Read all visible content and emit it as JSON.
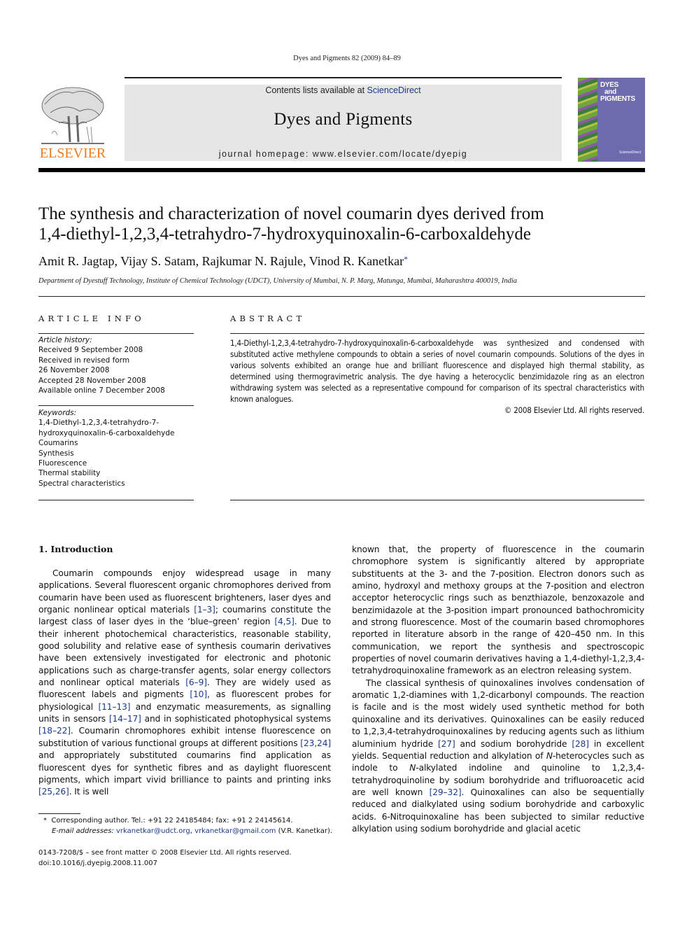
{
  "running_head": "Dyes and Pigments 82 (2009) 84–89",
  "banner": {
    "contents_prefix": "Contents lists available at ",
    "contents_link": "ScienceDirect",
    "journal_title": "Dyes and Pigments",
    "homepage": "journal homepage: www.elsevier.com/locate/dyepig"
  },
  "publisher_logo": {
    "wordmark": "ELSEVIER",
    "icon": "elsevier-tree-icon",
    "color": "#f07a1c"
  },
  "cover": {
    "title_lines": [
      "DYES",
      "and",
      "PIGMENTS"
    ],
    "footer": "ScienceDirect",
    "color": "#6e6aae"
  },
  "article": {
    "title_line1": "The synthesis and characterization of novel coumarin dyes derived from",
    "title_line2": "1,4-diethyl-1,2,3,4-tetrahydro-7-hydroxyquinoxalin-6-carboxaldehyde",
    "authors": "Amit R. Jagtap, Vijay S. Satam, Rajkumar N. Rajule, Vinod R. Kanetkar",
    "author_mark": "*",
    "affiliation": "Department of Dyestuff Technology, Institute of Chemical Technology (UDCT), University of Mumbai, N. P. Marg, Matunga, Mumbai, Maharashtra 400019, India"
  },
  "article_info": {
    "heading": "ARTICLE INFO",
    "history_label": "Article history:",
    "history": [
      "Received 9 September 2008",
      "Received in revised form",
      "26 November 2008",
      "Accepted 28 November 2008",
      "Available online 7 December 2008"
    ],
    "keywords_label": "Keywords:",
    "keywords": [
      "1,4-Diethyl-1,2,3,4-tetrahydro-7-",
      "hydroxyquinoxalin-6-carboxaldehyde",
      "Coumarins",
      "Synthesis",
      "Fluorescence",
      "Thermal stability",
      "Spectral characteristics"
    ]
  },
  "abstract": {
    "heading": "ABSTRACT",
    "text": "1,4-Diethyl-1,2,3,4-tetrahydro-7-hydroxyquinoxalin-6-carboxaldehyde was synthesized and condensed with substituted active methylene compounds to obtain a series of novel coumarin compounds. Solutions of the dyes in various solvents exhibited an orange hue and brilliant fluorescence and displayed high thermal stability, as determined using thermogravimetric analysis. The dye having a heterocyclic benzimidazole ring as an electron withdrawing system was selected as a representative compound for comparison of its spectral characteristics with known analogues.",
    "copyright": "© 2008 Elsevier Ltd. All rights reserved."
  },
  "intro": {
    "heading": "1.  Introduction",
    "left_paragraph": [
      {
        "t": "Coumarin compounds enjoy widespread usage in many applications. Several fluorescent organic chromophores derived from coumarin have been used as fluorescent brighteners, laser dyes and organic nonlinear optical materials "
      },
      {
        "r": "[1–3]"
      },
      {
        "t": "; coumarins constitute the largest class of laser dyes in the ‘blue–green’ region "
      },
      {
        "r": "[4,5]"
      },
      {
        "t": ". Due to their inherent photochemical characteristics, reasonable stability, good solubility and relative ease of synthesis coumarin derivatives have been extensively investigated for electronic and photonic applications such as charge-transfer agents, solar energy collectors and nonlinear optical materials "
      },
      {
        "r": "[6–9]"
      },
      {
        "t": ". They are widely used as fluorescent labels and pigments "
      },
      {
        "r": "[10]"
      },
      {
        "t": ", as fluorescent probes for physiological "
      },
      {
        "r": "[11–13]"
      },
      {
        "t": " and enzymatic measurements, as signalling units in sensors "
      },
      {
        "r": "[14–17]"
      },
      {
        "t": " and in sophisticated photophysical systems "
      },
      {
        "r": "[18–22]"
      },
      {
        "t": ". Coumarin chromophores exhibit intense fluorescence on substitution of various functional groups at different positions "
      },
      {
        "r": "[23,24]"
      },
      {
        "t": " and appropriately substituted coumarins find application as fluorescent dyes for synthetic fibres and as daylight fluorescent pigments, which impart vivid brilliance to paints and printing inks "
      },
      {
        "r": "[25,26]"
      },
      {
        "t": ". It is well"
      }
    ],
    "right_paragraph1": "known that, the property of fluorescence in the coumarin chromophore system is significantly altered by appropriate substituents at the 3- and the 7-position. Electron donors such as amino, hydroxyl and methoxy groups at the 7-position and electron acceptor heterocyclic rings such as benzthiazole, benzoxazole and benzimidazole at the 3-position impart pronounced bathochromicity and strong fluorescence. Most of the coumarin based chromophores reported in literature absorb in the range of 420–450 nm. In this communication, we report the synthesis and spectroscopic properties of novel coumarin derivatives having a 1,4-diethyl-1,2,3,4-tetrahydroquinoxaline framework as an electron releasing system.",
    "right_paragraph2": [
      {
        "t": "The classical synthesis of quinoxalines involves condensation of aromatic 1,2-diamines with 1,2-dicarbonyl compounds. The reaction is facile and is the most widely used synthetic method for both quinoxaline and its derivatives. Quinoxalines can be easily reduced to 1,2,3,4-tetrahydroquinoxalines by reducing agents such as lithium aluminium hydride "
      },
      {
        "r": "[27]"
      },
      {
        "t": " and sodium borohydride "
      },
      {
        "r": "[28]"
      },
      {
        "t": " in excellent yields. Sequential reduction and alkylation of "
      },
      {
        "i": "N"
      },
      {
        "t": "-heterocycles such as indole to "
      },
      {
        "i": "N"
      },
      {
        "t": "-alkylated indoline and quinoline to 1,2,3,4-tetrahydroquinoline by sodium borohydride and trifluoroacetic acid are well known "
      },
      {
        "r": "[29–32]"
      },
      {
        "t": ". Quinoxalines can also be sequentially reduced and dialkylated using sodium borohydride and carboxylic acids. 6-Nitroquinoxaline has been subjected to similar reductive alkylation using sodium borohydride and glacial acetic"
      }
    ]
  },
  "footnote": {
    "mark": "*",
    "corresponding": "Corresponding author. Tel.: +91 22 24185484; fax: +91 2 24145614.",
    "email_label": "E-mail addresses:",
    "email1": "vrkanetkar@udct.org",
    "email2": "vrkanetkar@gmail.com",
    "email_suffix": "(V.R. Kanetkar).",
    "issn": "0143-7208/$ – see front matter © 2008 Elsevier Ltd. All rights reserved.",
    "doi": "doi:10.1016/j.dyepig.2008.11.007"
  }
}
